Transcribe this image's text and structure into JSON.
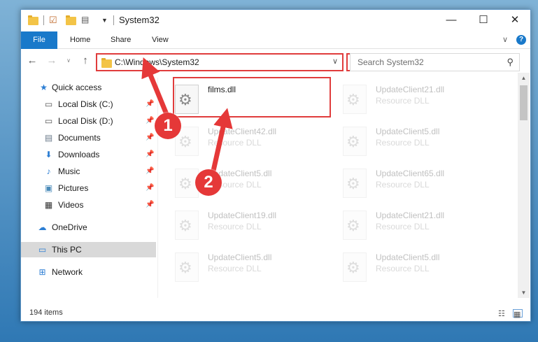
{
  "window": {
    "title": "System32",
    "controls": {
      "minimize": "—",
      "maximize": "☐",
      "close": "✕"
    }
  },
  "ribbon": {
    "tabs": [
      {
        "label": "File"
      },
      {
        "label": "Home"
      },
      {
        "label": "Share"
      },
      {
        "label": "View"
      }
    ]
  },
  "address": {
    "path": "C:\\Windows\\System32",
    "search_placeholder": "Search System32"
  },
  "navpane": {
    "items": [
      {
        "label": "Quick access"
      },
      {
        "label": "Local Disk (C:)"
      },
      {
        "label": "Local Disk (D:)"
      },
      {
        "label": "Documents"
      },
      {
        "label": "Downloads"
      },
      {
        "label": "Music"
      },
      {
        "label": "Pictures"
      },
      {
        "label": "Videos"
      },
      {
        "label": "OneDrive"
      },
      {
        "label": "This PC"
      },
      {
        "label": "Network"
      }
    ]
  },
  "files": [
    {
      "name": "films.dll",
      "type": ""
    },
    {
      "name": "UpdateClient21.dll",
      "type": "Resource DLL"
    },
    {
      "name": "UpdateClient42.dll",
      "type": "Resource DLL"
    },
    {
      "name": "UpdateClient5.dll",
      "type": "Resource DLL"
    },
    {
      "name": "UpdateClient5.dll",
      "type": "Resource DLL"
    },
    {
      "name": "UpdateClient65.dll",
      "type": "Resource DLL"
    },
    {
      "name": "UpdateClient19.dll",
      "type": "Resource DLL"
    },
    {
      "name": "UpdateClient21.dll",
      "type": "Resource DLL"
    },
    {
      "name": "UpdateClient5.dll",
      "type": "Resource DLL"
    },
    {
      "name": "UpdateClient5.dll",
      "type": "Resource DLL"
    }
  ],
  "status": {
    "item_count": "194 items"
  },
  "annotations": {
    "step1": "1",
    "step2": "2",
    "color": "#e53838"
  }
}
